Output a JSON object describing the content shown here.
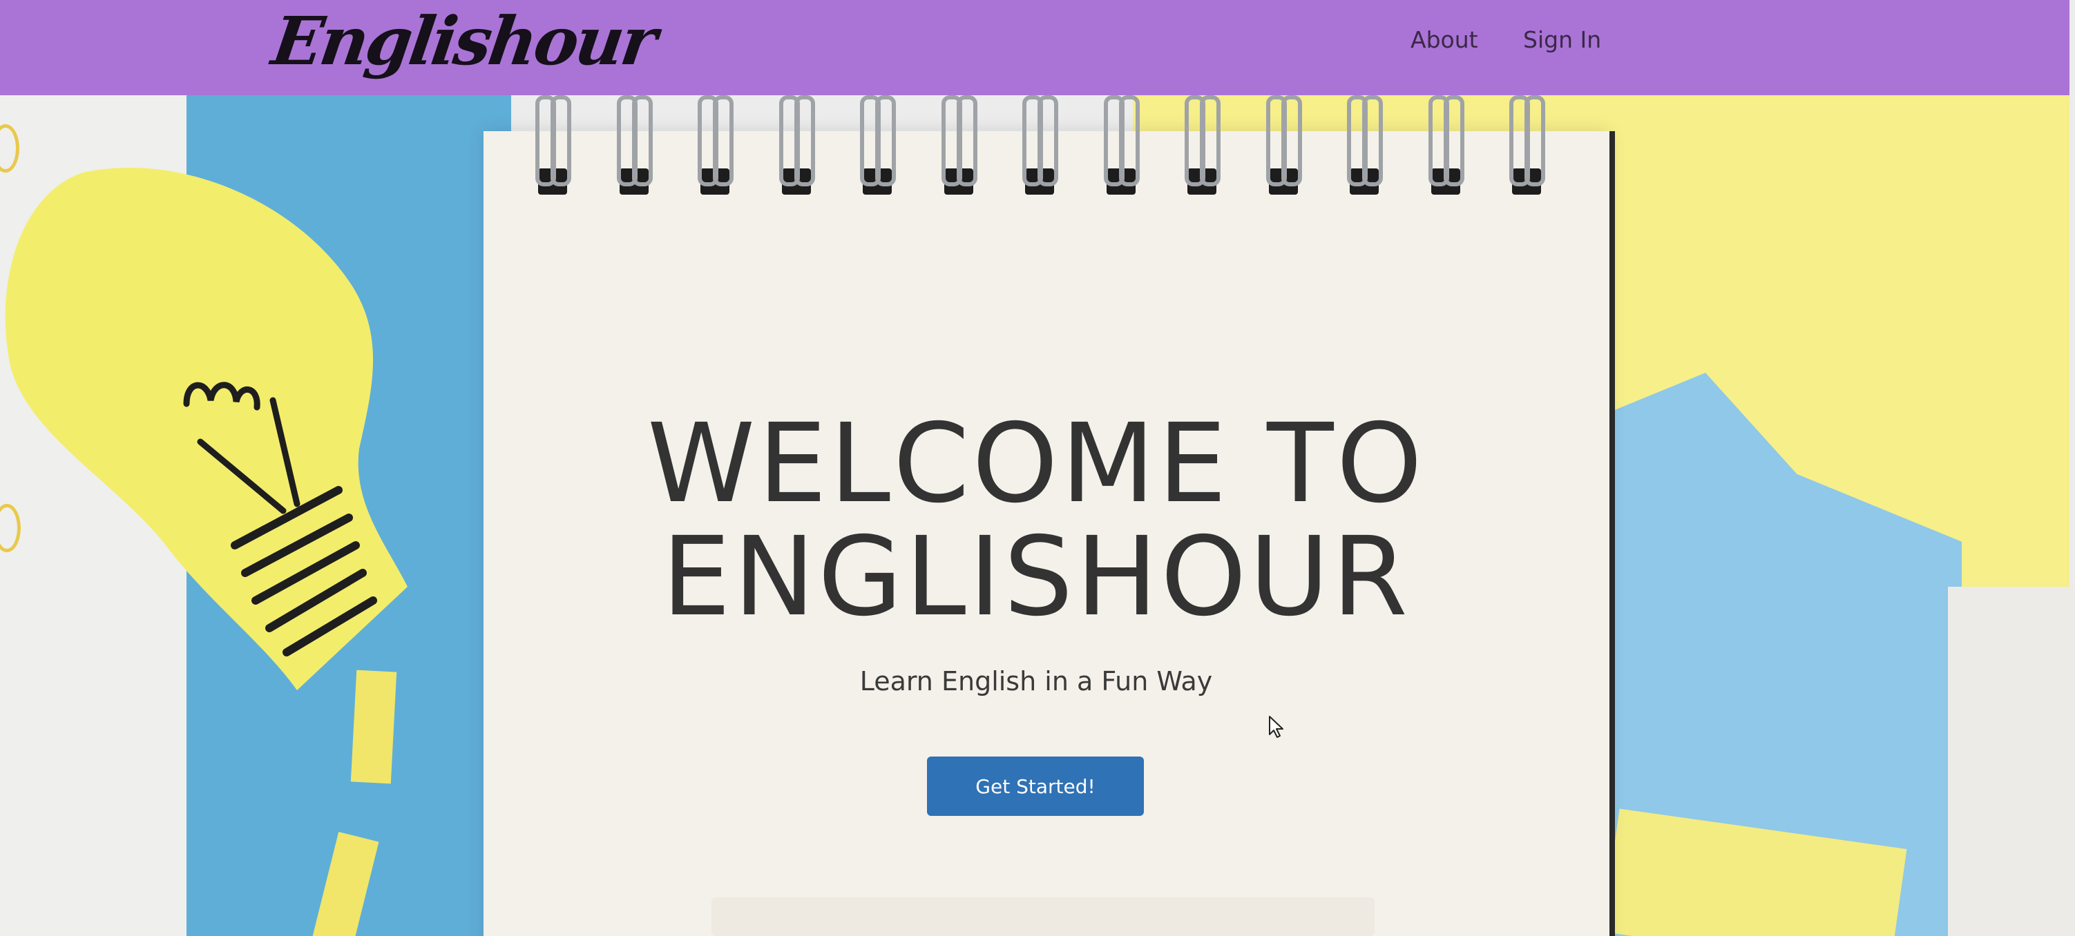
{
  "navbar": {
    "brand": "Englishour",
    "links": [
      {
        "label": "About"
      },
      {
        "label": "Sign In"
      }
    ],
    "background_color": "#aa74d6"
  },
  "hero": {
    "title_line1": "WELCOME TO",
    "title_line2": "ENGLISHOUR",
    "subtitle": "Learn English in a Fun Way",
    "cta_label": "Get Started!",
    "cta_color": "#2f72b5"
  },
  "icons": [
    "lightbulb-illustration-icon",
    "spiral-ring-icon",
    "mouse-cursor-icon"
  ]
}
